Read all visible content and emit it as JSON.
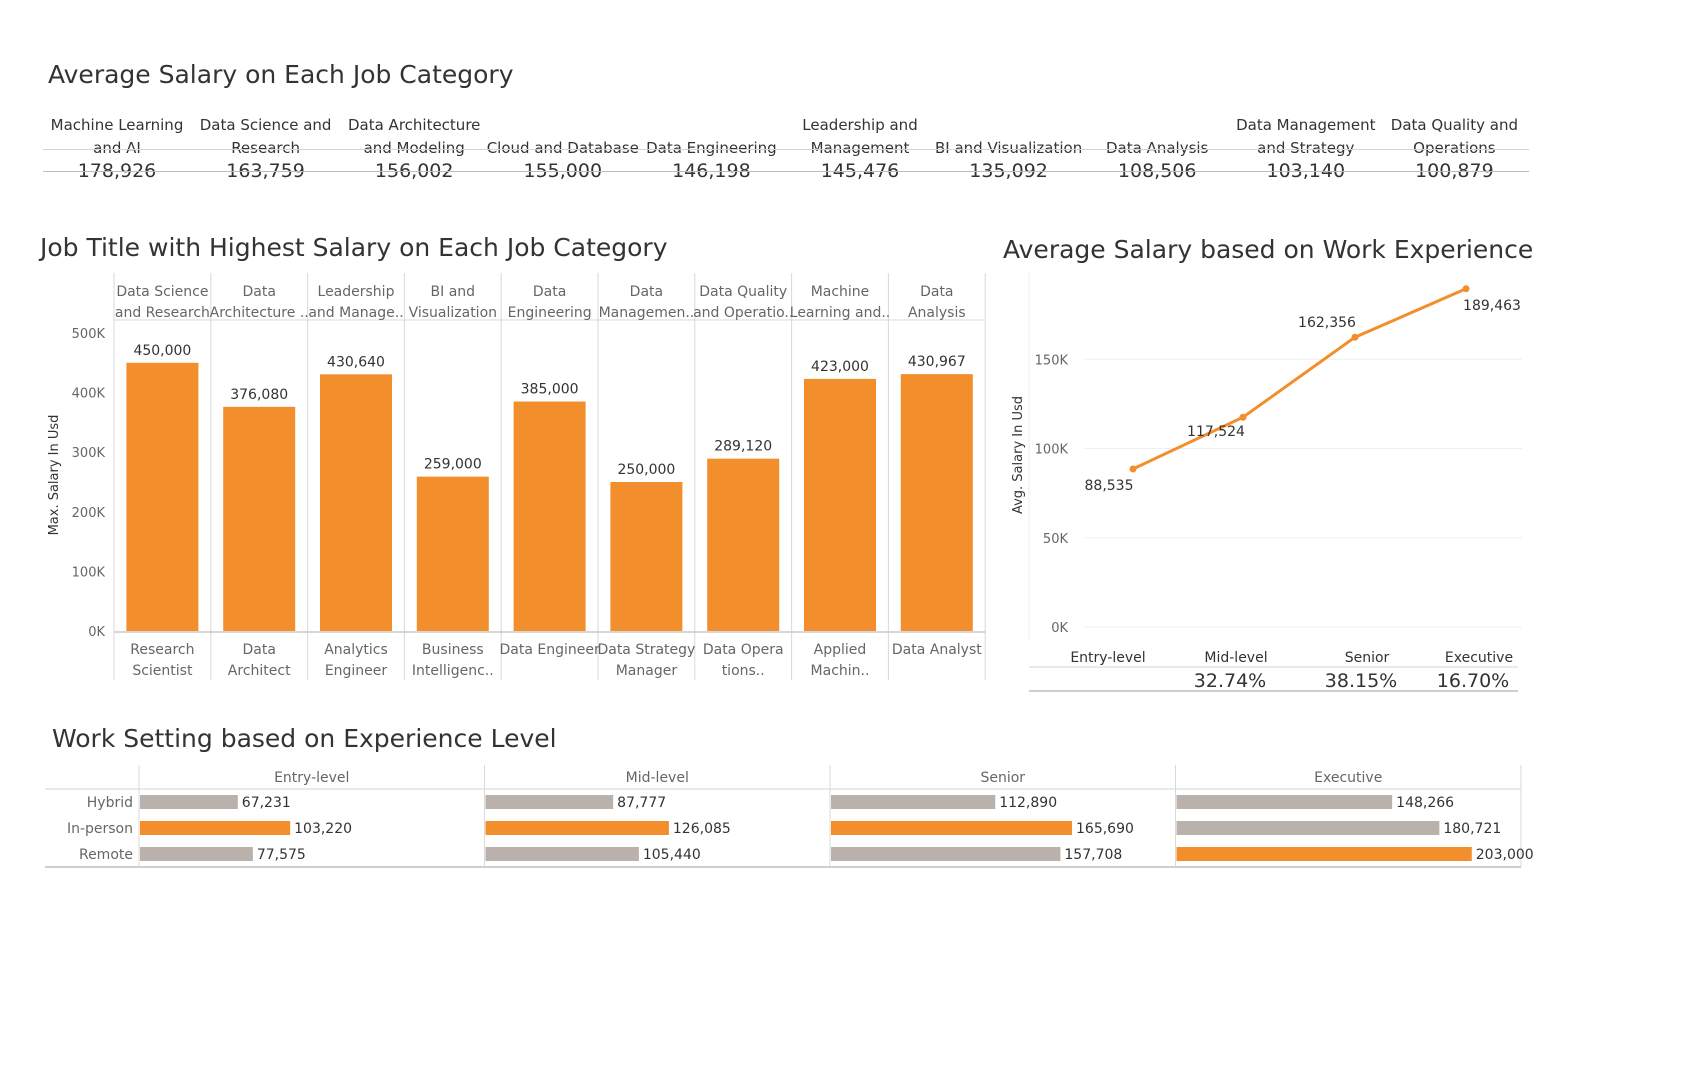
{
  "salary_table": {
    "title": "Average Salary on Each Job Category",
    "categories": [
      {
        "name": "Machine Learning and AI",
        "value": "178,926"
      },
      {
        "name": "Data Science and Research",
        "value": "163,759"
      },
      {
        "name": "Data Architecture and Modeling",
        "value": "156,002"
      },
      {
        "name": "Cloud and Database",
        "value": "155,000"
      },
      {
        "name": "Data Engineering",
        "value": "146,198"
      },
      {
        "name": "Leadership and Management",
        "value": "145,476"
      },
      {
        "name": "BI and Visualization",
        "value": "135,092"
      },
      {
        "name": "Data Analysis",
        "value": "108,506"
      },
      {
        "name": "Data Management and Strategy",
        "value": "103,140"
      },
      {
        "name": "Data Quality and Operations",
        "value": "100,879"
      }
    ]
  },
  "chart_data": [
    {
      "type": "bar",
      "title": "Job Title with Highest Salary on Each Job Category",
      "ylabel": "Max. Salary In Usd",
      "ylim": [
        0,
        500000
      ],
      "yticks": [
        "0K",
        "100K",
        "200K",
        "300K",
        "400K",
        "500K"
      ],
      "groups": [
        "Data Science and Research",
        "Data Architecture ..",
        "Leadership and Manage..",
        "BI and Visualization",
        "Data Engineering",
        "Data Managemen..",
        "Data Quality and Operatio..",
        "Machine Learning and..",
        "Data Analysis"
      ],
      "categories": [
        "Research Scientist",
        "Data Architect",
        "Analytics Engineer",
        "Business Intelligenc..",
        "Data Engineer",
        "Data Strategy Manager",
        "Data Opera tions..",
        "Applied Machin..",
        "Data Analyst"
      ],
      "values": [
        450000,
        376080,
        430640,
        259000,
        385000,
        250000,
        289120,
        423000,
        430967
      ],
      "value_labels": [
        "450,000",
        "376,080",
        "430,640",
        "259,000",
        "385,000",
        "250,000",
        "289,120",
        "423,000",
        "430,967"
      ],
      "color": "#f28e2b",
      "grid": false
    },
    {
      "type": "line",
      "title": "Average Salary based on Work Experience",
      "ylabel": "Avg. Salary In Usd",
      "ylim": [
        0,
        200000
      ],
      "yticks": [
        "0K",
        "50K",
        "100K",
        "150K"
      ],
      "x": [
        "Entry-level",
        "Mid-level",
        "Senior",
        "Executive"
      ],
      "values": [
        88535,
        117524,
        162356,
        189463
      ],
      "value_labels": [
        "88,535",
        "117,524",
        "162,356",
        "189,463"
      ],
      "percents": [
        "",
        "32.74%",
        "38.15%",
        "16.70%"
      ],
      "color": "#f28e2b",
      "grid": true
    },
    {
      "type": "bar",
      "orientation": "horizontal",
      "title": "Work Setting based on Experience Level",
      "panels": [
        "Entry-level",
        "Mid-level",
        "Senior",
        "Executive"
      ],
      "categories": [
        "Hybrid",
        "In-person",
        "Remote"
      ],
      "xlim": [
        0,
        220000
      ],
      "series": [
        {
          "panel": "Entry-level",
          "values": [
            67231,
            103220,
            77575
          ],
          "labels": [
            "67,231",
            "103,220",
            "77,575"
          ],
          "highlight": 1
        },
        {
          "panel": "Mid-level",
          "values": [
            87777,
            126085,
            105440
          ],
          "labels": [
            "87,777",
            "126,085",
            "105,440"
          ],
          "highlight": 1
        },
        {
          "panel": "Senior",
          "values": [
            112890,
            165690,
            157708
          ],
          "labels": [
            "112,890",
            "165,690",
            "157,708"
          ],
          "highlight": 1
        },
        {
          "panel": "Executive",
          "values": [
            148266,
            180721,
            203000
          ],
          "labels": [
            "148,266",
            "180,721",
            "203,000"
          ],
          "highlight": 2
        }
      ],
      "highlight_color": "#f28e2b",
      "base_color": "#bab0ac"
    }
  ]
}
